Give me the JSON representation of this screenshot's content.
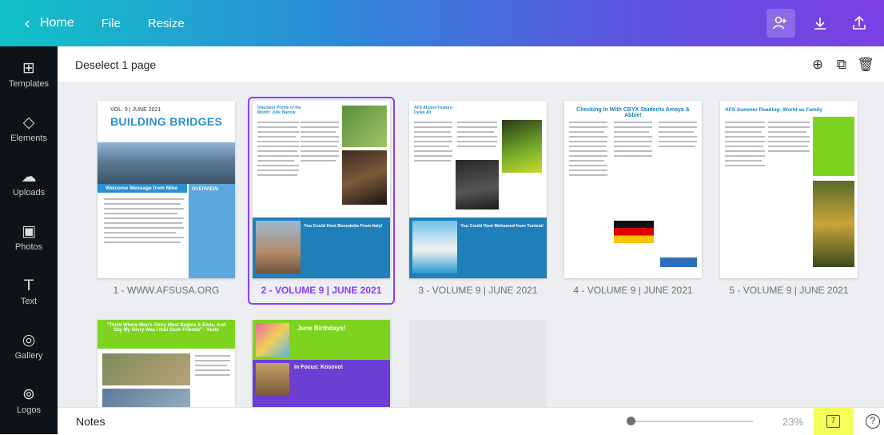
{
  "topbar": {
    "home_label": "Home",
    "file_label": "File",
    "resize_label": "Resize",
    "icons": [
      "share-people-icon",
      "download-icon",
      "upload-share-icon"
    ]
  },
  "sidebar": {
    "items": [
      {
        "label": "Templates",
        "icon": "templates-icon"
      },
      {
        "label": "Elements",
        "icon": "elements-icon"
      },
      {
        "label": "Uploads",
        "icon": "uploads-icon"
      },
      {
        "label": "Photos",
        "icon": "photos-icon"
      },
      {
        "label": "Text",
        "icon": "text-icon"
      },
      {
        "label": "Gallery",
        "icon": "gallery-icon"
      },
      {
        "label": "Logos",
        "icon": "logos-icon"
      }
    ]
  },
  "subbar": {
    "deselect_label": "Deselect 1 page",
    "icons": [
      "add-page-icon",
      "duplicate-page-icon",
      "delete-page-icon"
    ]
  },
  "pages": [
    {
      "label": "1 - WWW.AFSUSA.ORG",
      "selected": false,
      "kicker": "VOL. 9 | JUNE 2021",
      "title": "BUILDING BRIDGES",
      "section": "Welcome Message from Mike",
      "side": "OVERVIEW:"
    },
    {
      "label": "2 - VOLUME 9 | JUNE 2021",
      "selected": true,
      "title": "Volunteer Profile of the Month: Julie Barlow",
      "banner": "You Could Host Benedetta From Italy!"
    },
    {
      "label": "3 - VOLUME 9 | JUNE 2021",
      "selected": false,
      "title": "AFS Alumni Feature: Dylan Ali",
      "banner": "You Could Host Mohamed from Tunisia!"
    },
    {
      "label": "4 - VOLUME 9 | JUNE 2021",
      "selected": false,
      "title": "Checking In With CBYX Students Amaya & Abbie!"
    },
    {
      "label": "5 - VOLUME 9 | JUNE 2021",
      "selected": false,
      "title": "AFS Summer Reading: World as Family"
    },
    {
      "label": "",
      "selected": false,
      "title": "\"Think Where Man's Glory Most Begins & Ends, And Say My Glory Was I Had Such Friends\" - Yeats"
    },
    {
      "label": "",
      "selected": false,
      "title": "June Birthdays!",
      "banner": "In Focus: Kosovo!"
    }
  ],
  "bottombar": {
    "notes_label": "Notes",
    "zoom_label": "23%",
    "grid_view_value": "7",
    "help_label": "?"
  },
  "colors": {
    "accent": "#8b3dff",
    "page1_title": "#2c8fcf",
    "blue_banner": "#1f7fb8",
    "lime": "#7ed321",
    "purple": "#6b3fd1"
  }
}
